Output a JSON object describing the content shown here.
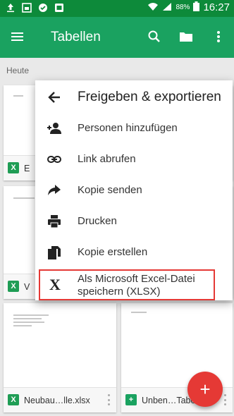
{
  "status_bar": {
    "battery_percent": "88%",
    "time": "16:27"
  },
  "app_bar": {
    "title": "Tabellen"
  },
  "section": {
    "label": "Heute"
  },
  "files": [
    {
      "name": "E",
      "type": "excel"
    },
    {
      "name": "V",
      "type": "excel"
    },
    {
      "name": "Neubau…lle.xlsx",
      "type": "excel"
    },
    {
      "name": "Unben…Tabelle",
      "type": "sheet"
    }
  ],
  "menu": {
    "title": "Freigeben & exportieren",
    "items": [
      {
        "label": "Personen hinzufügen",
        "icon": "person-add-icon"
      },
      {
        "label": "Link abrufen",
        "icon": "link-icon"
      },
      {
        "label": "Kopie senden",
        "icon": "send-icon"
      },
      {
        "label": "Drucken",
        "icon": "print-icon"
      },
      {
        "label": "Kopie erstellen",
        "icon": "copy-icon"
      },
      {
        "label": "Als Microsoft Excel-Datei speichern (XLSX)",
        "icon": "excel-x-icon"
      }
    ]
  },
  "fab": {
    "symbol": "+"
  },
  "colors": {
    "status_bar": "#0d8a3a",
    "app_bar": "#1aa260",
    "fab": "#e53935",
    "highlight_border": "#e53935"
  }
}
